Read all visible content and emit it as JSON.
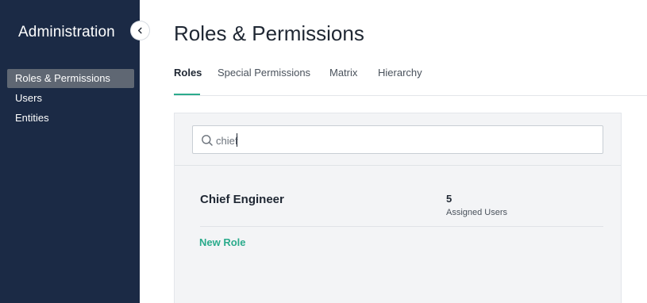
{
  "sidebar": {
    "title": "Administration",
    "items": [
      {
        "label": "Roles & Permissions",
        "active": true
      },
      {
        "label": "Users",
        "active": false
      },
      {
        "label": "Entities",
        "active": false
      }
    ]
  },
  "main": {
    "title": "Roles & Permissions",
    "tabs": [
      {
        "label": "Roles",
        "active": true
      },
      {
        "label": "Special Permissions",
        "active": false
      },
      {
        "label": "Matrix",
        "active": false
      },
      {
        "label": "Hierarchy",
        "active": false
      }
    ],
    "search": {
      "value": "chief"
    },
    "roles": [
      {
        "name": "Chief Engineer",
        "count": "5",
        "count_label": "Assigned Users"
      }
    ],
    "new_role_label": "New Role"
  },
  "colors": {
    "sidebar_bg": "#1b2a45",
    "accent": "#2bab8c",
    "active_nav_bg": "#5f6773"
  },
  "icons": [
    "chevron-left-icon",
    "search-icon"
  ]
}
